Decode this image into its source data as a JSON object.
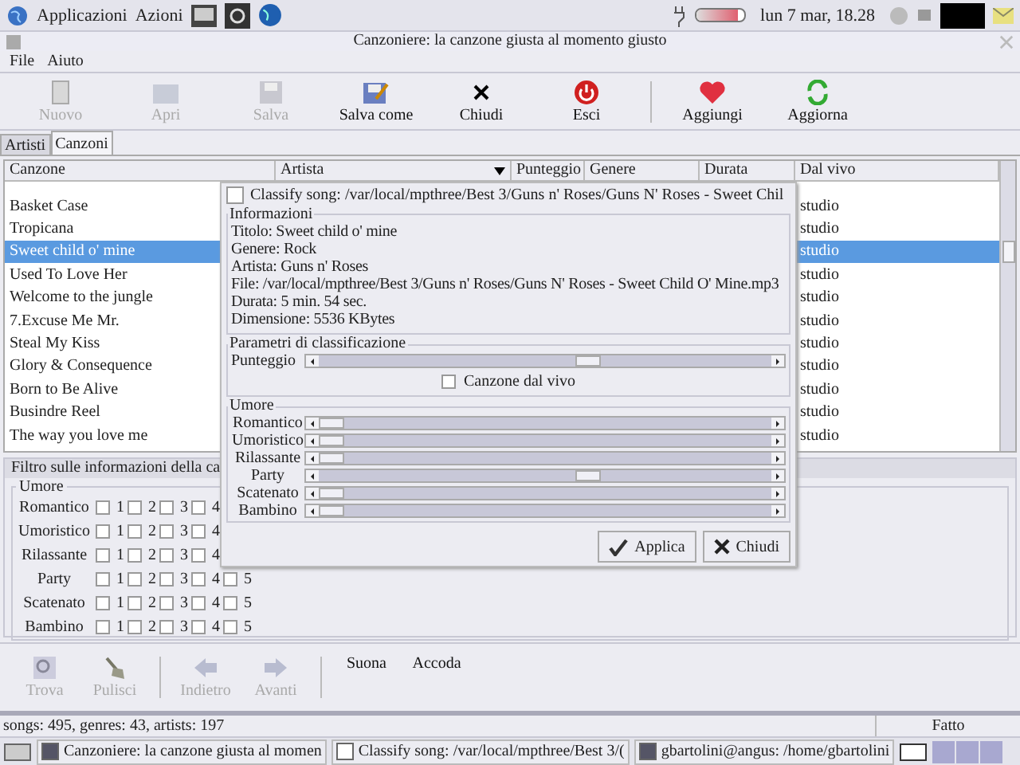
{
  "top_panel": {
    "menus": [
      "Applicazioni",
      "Azioni"
    ],
    "clock": "lun  7 mar, 18.28",
    "battery": {
      "level": 0.85
    }
  },
  "window": {
    "title": "Canzoniere: la canzone giusta al momento giusto"
  },
  "menu": [
    "File",
    "Aiuto"
  ],
  "toolbar": [
    {
      "label": "Nuovo",
      "disabled": true
    },
    {
      "label": "Apri",
      "disabled": true
    },
    {
      "label": "Salva",
      "disabled": true
    },
    {
      "label": "Salva come",
      "disabled": false
    },
    {
      "label": "Chiudi",
      "disabled": false
    },
    {
      "label": "Esci",
      "disabled": false
    },
    {
      "label": "Aggiungi",
      "disabled": false
    },
    {
      "label": "Aggiorna",
      "disabled": false
    }
  ],
  "tabs": [
    {
      "label": "Artisti",
      "selected": false
    },
    {
      "label": "Canzoni",
      "selected": true
    }
  ],
  "table": {
    "columns": [
      "Canzone",
      "Artista",
      "Punteggio",
      "Genere",
      "Durata",
      "Dal vivo"
    ],
    "rows": [
      {
        "canzone": "Basket Case",
        "dal_vivo": "studio",
        "selected": false
      },
      {
        "canzone": "Tropicana",
        "dal_vivo": "studio",
        "selected": false
      },
      {
        "canzone": "Sweet child o' mine",
        "dal_vivo": "studio",
        "selected": true
      },
      {
        "canzone": "Used To Love Her",
        "dal_vivo": "studio",
        "selected": false
      },
      {
        "canzone": "Welcome to the jungle",
        "dal_vivo": "studio",
        "selected": false
      },
      {
        "canzone": "7.Excuse Me Mr.",
        "dal_vivo": "studio",
        "selected": false
      },
      {
        "canzone": "Steal My Kiss",
        "dal_vivo": "studio",
        "selected": false
      },
      {
        "canzone": "Glory & Consequence",
        "dal_vivo": "studio",
        "selected": false
      },
      {
        "canzone": "Born to Be Alive",
        "dal_vivo": "studio",
        "selected": false
      },
      {
        "canzone": "Busindre Reel",
        "dal_vivo": "studio",
        "selected": false
      },
      {
        "canzone": "The way you love me",
        "dal_vivo": "studio",
        "selected": false
      }
    ]
  },
  "filter": {
    "title": "Filtro sulle informazioni della ca",
    "group": "Umore",
    "rows": [
      {
        "label": "Romantico",
        "options": [
          {
            "label": "1",
            "checked": false
          },
          {
            "label": "2",
            "checked": false
          },
          {
            "label": "3",
            "checked": false
          },
          {
            "label": "4",
            "checked": false
          }
        ]
      },
      {
        "label": "Umoristico",
        "options": [
          {
            "label": "1",
            "checked": false
          },
          {
            "label": "2",
            "checked": false
          },
          {
            "label": "3",
            "checked": false
          },
          {
            "label": "4",
            "checked": false
          }
        ]
      },
      {
        "label": "Rilassante",
        "options": [
          {
            "label": "1",
            "checked": false
          },
          {
            "label": "2",
            "checked": false
          },
          {
            "label": "3",
            "checked": false
          },
          {
            "label": "4",
            "checked": false
          }
        ]
      },
      {
        "label": "Party",
        "options": [
          {
            "label": "1",
            "checked": false
          },
          {
            "label": "2",
            "checked": false
          },
          {
            "label": "3",
            "checked": false
          },
          {
            "label": "4",
            "checked": false
          },
          {
            "label": "5",
            "checked": false
          }
        ]
      },
      {
        "label": "Scatenato",
        "options": [
          {
            "label": "1",
            "checked": false
          },
          {
            "label": "2",
            "checked": false
          },
          {
            "label": "3",
            "checked": false
          },
          {
            "label": "4",
            "checked": false
          },
          {
            "label": "5",
            "checked": false
          }
        ]
      },
      {
        "label": "Bambino",
        "options": [
          {
            "label": "1",
            "checked": false
          },
          {
            "label": "2",
            "checked": false
          },
          {
            "label": "3",
            "checked": false
          },
          {
            "label": "4",
            "checked": false
          },
          {
            "label": "5",
            "checked": false
          }
        ]
      }
    ]
  },
  "bottom_toolbar": [
    {
      "label": "Trova",
      "disabled": true
    },
    {
      "label": "Pulisci",
      "disabled": true
    },
    {
      "label": "Indietro",
      "disabled": true
    },
    {
      "label": "Avanti",
      "disabled": true
    },
    {
      "label": "Suona",
      "disabled": false
    },
    {
      "label": "Accoda",
      "disabled": false
    }
  ],
  "status_bar": {
    "text": "songs: 495, genres: 43, artists: 197",
    "state": "Fatto"
  },
  "dialog": {
    "title": "Classify song: /var/local/mpthree/Best 3/Guns n' Roses/Guns N' Roses - Sweet Chil",
    "checked": false,
    "info_title": "Informazioni",
    "info": [
      "Titolo: Sweet child o' mine",
      "Genere: Rock",
      "Artista: Guns n' Roses",
      "File: /var/local/mpthree/Best 3/Guns n' Roses/Guns N' Roses - Sweet Child O' Mine.mp3",
      "Durata: 5 min. 54 sec.",
      "Dimensione: 5536 KBytes"
    ],
    "params_title": "Parametri di classificazione",
    "score": {
      "label": "Punteggio",
      "level": 0.6
    },
    "live": {
      "label": "Canzone dal vivo",
      "checked": false
    },
    "mood_title": "Umore",
    "moods": [
      {
        "label": "Romantico",
        "level": 0
      },
      {
        "label": "Umoristico",
        "level": 0
      },
      {
        "label": "Rilassante",
        "level": 0
      },
      {
        "label": "Party",
        "level": 0.6
      },
      {
        "label": "Scatenato",
        "level": 0
      },
      {
        "label": "Bambino",
        "level": 0
      }
    ],
    "buttons": [
      "Applica",
      "Chiudi"
    ]
  },
  "taskbar": [
    "Canzoniere: la canzone giusta al momen",
    "Classify song: /var/local/mpthree/Best 3/(",
    "gbartolini@angus: /home/gbartolini"
  ]
}
